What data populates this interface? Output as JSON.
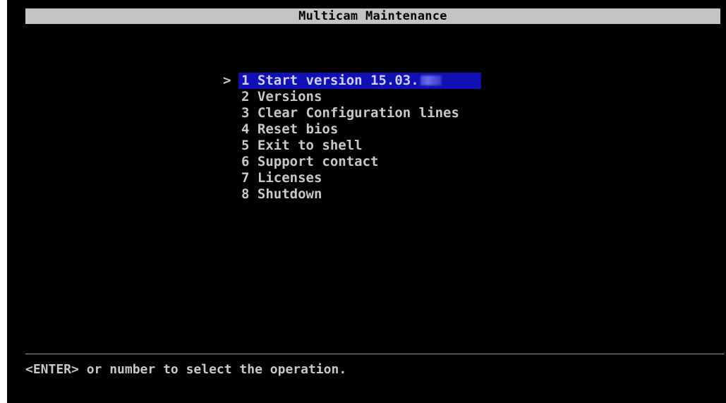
{
  "window": {
    "title": "Multicam Maintenance"
  },
  "menu": {
    "cursor": ">",
    "selected_index": 0,
    "items": [
      {
        "number": "1",
        "label": "Start version 15.03.",
        "redacted_suffix": true
      },
      {
        "number": "2",
        "label": "Versions"
      },
      {
        "number": "3",
        "label": "Clear Configuration lines"
      },
      {
        "number": "4",
        "label": "Reset bios"
      },
      {
        "number": "5",
        "label": "Exit to shell"
      },
      {
        "number": "6",
        "label": "Support contact"
      },
      {
        "number": "7",
        "label": "Licenses"
      },
      {
        "number": "8",
        "label": "Shutdown"
      }
    ]
  },
  "status": {
    "hint": "<ENTER> or number to select the operation."
  },
  "colors": {
    "background": "#000000",
    "text": "#c8c8c8",
    "title_bar": "#c4c4c4",
    "selection": "#1010b4"
  }
}
